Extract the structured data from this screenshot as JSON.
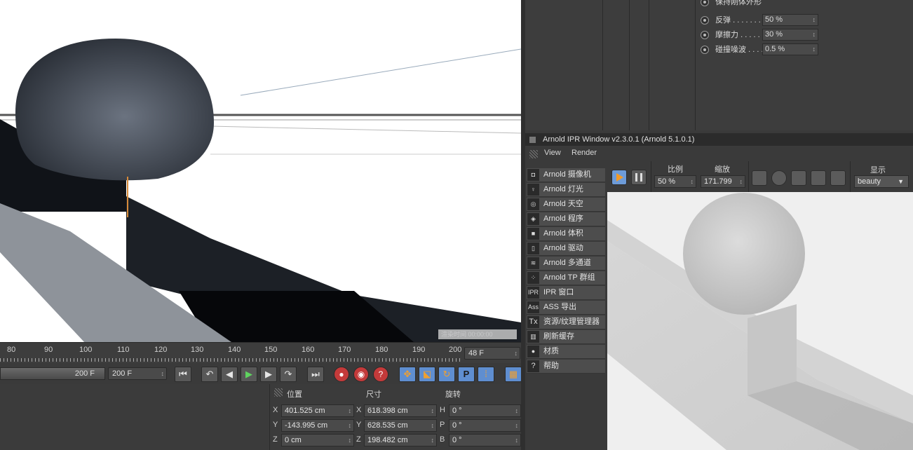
{
  "viewport": {
    "watermark": "渲染时间 00:00:00"
  },
  "timeline": {
    "ticks": [
      "80",
      "90",
      "100",
      "110",
      "120",
      "130",
      "140",
      "150",
      "160",
      "170",
      "180",
      "190",
      "200"
    ],
    "current_frame": "48 F",
    "end_frame_a": "200 F",
    "end_frame_b": "200 F"
  },
  "transport": {
    "goto_start": "⏮",
    "prev_key": "↶",
    "prev_frame": "◀",
    "play": "▶",
    "next_frame": "▶",
    "next_key": "↷",
    "goto_end": "⏭",
    "record": "●",
    "autokey": "◉",
    "keyhelp": "?",
    "move": "✥",
    "scale": "⬕",
    "rotate": "↻",
    "param": "P",
    "grid": "⁞",
    "film": "▦"
  },
  "coords": {
    "header_position": "位置",
    "header_size": "尺寸",
    "header_rotation": "旋转",
    "rows": [
      {
        "axis1": "X",
        "pos": "401.525 cm",
        "axis2": "X",
        "size": "618.398 cm",
        "axis3": "H",
        "rot": "0 °"
      },
      {
        "axis1": "Y",
        "pos": "-143.995 cm",
        "axis2": "Y",
        "size": "628.535 cm",
        "axis3": "P",
        "rot": "0 °"
      },
      {
        "axis1": "Z",
        "pos": "0 cm",
        "axis2": "Z",
        "size": "198.482 cm",
        "axis3": "B",
        "rot": "0 °"
      }
    ]
  },
  "attr": {
    "keep_shape": "保持刚体外形",
    "rows": [
      {
        "label": "反弹 . . . . . . .",
        "value": "50 %"
      },
      {
        "label": "摩擦力 . . . . . .",
        "value": "30 %"
      },
      {
        "label": "碰撞噪波 . . . .",
        "value": "0.5 %"
      }
    ]
  },
  "ipr": {
    "title": "Arnold IPR Window v2.3.0.1 (Arnold 5.1.0.1)",
    "menu": [
      "View",
      "Render"
    ],
    "side_items": [
      {
        "icon": "cam",
        "label": "Arnold 摄像机"
      },
      {
        "icon": "bulb",
        "label": "Arnold 灯光"
      },
      {
        "icon": "globe",
        "label": "Arnold 天空"
      },
      {
        "icon": "cube",
        "label": "Arnold 程序"
      },
      {
        "icon": "vol",
        "label": "Arnold 体积"
      },
      {
        "icon": "doc",
        "label": "Arnold 驱动"
      },
      {
        "icon": "layers",
        "label": "Arnold 多通道"
      },
      {
        "icon": "dots",
        "label": "Arnold TP 群组"
      },
      {
        "icon": "IPR",
        "label": "IPR 窗口"
      },
      {
        "icon": "Ass",
        "label": "ASS 导出"
      },
      {
        "icon": "Tx",
        "label": "资源/纹理管理器"
      },
      {
        "icon": "trash",
        "label": "刷新缓存"
      },
      {
        "icon": "ball",
        "label": "材质"
      },
      {
        "icon": "?",
        "label": "帮助"
      }
    ],
    "toolbar": {
      "ratio_label": "比例",
      "ratio_value": "50 %",
      "zoom_label": "缩放",
      "zoom_value": "171.799",
      "display_label": "显示",
      "display_value": "beauty"
    }
  }
}
